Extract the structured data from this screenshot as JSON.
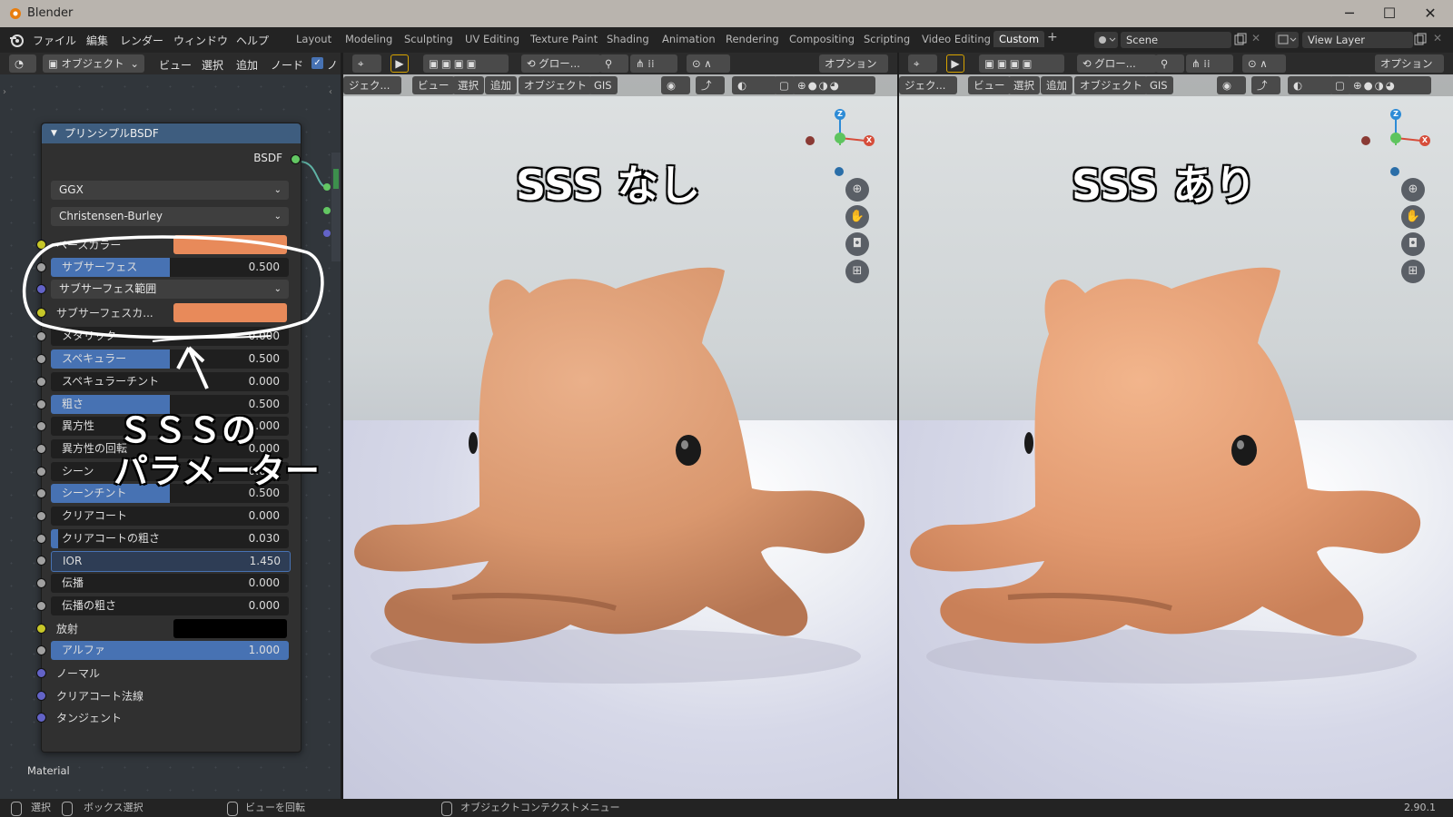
{
  "window": {
    "title": "Blender",
    "minimize": "─",
    "maximize": "☐",
    "close": "✕"
  },
  "menu": {
    "file": "ファイル",
    "edit": "編集",
    "render": "レンダー",
    "window": "ウィンドウ",
    "help": "ヘルプ"
  },
  "workspaces": [
    "Layout",
    "Modeling",
    "Sculpting",
    "UV Editing",
    "Texture Paint",
    "Shading",
    "Animation",
    "Rendering",
    "Compositing",
    "Scripting",
    "Video Editing",
    "Custom"
  ],
  "active_workspace": "Custom",
  "add_workspace": "+",
  "scene": {
    "name": "Scene",
    "view_layer": "View Layer"
  },
  "node_editor": {
    "header": {
      "object": "オブジェクト",
      "view": "ビュー",
      "select": "選択",
      "add": "追加",
      "node": "ノード",
      "extra": "ノ"
    },
    "footer_label": "Material",
    "node": {
      "title": "プリンシプルBSDF",
      "output": "BSDF",
      "distribution": "GGX",
      "subsurface_method": "Christensen-Burley",
      "inputs": [
        {
          "label": "ベースカラー",
          "kind": "color",
          "color": "#e88a5a"
        },
        {
          "label": "サブサーフェス",
          "kind": "slider",
          "value": "0.500",
          "fill": 0.5
        },
        {
          "label": "サブサーフェス範囲",
          "kind": "dropdown"
        },
        {
          "label": "サブサーフェスカ...",
          "kind": "color",
          "color": "#e88a5a"
        },
        {
          "label": "メタリック",
          "kind": "slider",
          "value": "0.000",
          "fill": 0
        },
        {
          "label": "スペキュラー",
          "kind": "slider",
          "value": "0.500",
          "fill": 0.5
        },
        {
          "label": "スペキュラーチント",
          "kind": "slider",
          "value": "0.000",
          "fill": 0
        },
        {
          "label": "粗さ",
          "kind": "slider",
          "value": "0.500",
          "fill": 0.5
        },
        {
          "label": "異方性",
          "kind": "slider",
          "value": "0.000",
          "fill": 0
        },
        {
          "label": "異方性の回転",
          "kind": "slider",
          "value": "0.000",
          "fill": 0
        },
        {
          "label": "シーン",
          "kind": "slider",
          "value": "0.000",
          "fill": 0
        },
        {
          "label": "シーンチント",
          "kind": "slider",
          "value": "0.500",
          "fill": 0.5
        },
        {
          "label": "クリアコート",
          "kind": "slider",
          "value": "0.000",
          "fill": 0
        },
        {
          "label": "クリアコートの粗さ",
          "kind": "slider",
          "value": "0.030",
          "fill": 0.03
        },
        {
          "label": "IOR",
          "kind": "field",
          "value": "1.450"
        },
        {
          "label": "伝播",
          "kind": "slider",
          "value": "0.000",
          "fill": 0
        },
        {
          "label": "伝播の粗さ",
          "kind": "slider",
          "value": "0.000",
          "fill": 0
        },
        {
          "label": "放射",
          "kind": "color",
          "color": "#000000"
        },
        {
          "label": "アルファ",
          "kind": "slider",
          "value": "1.000",
          "fill": 1
        },
        {
          "label": "ノーマル",
          "kind": "plain"
        },
        {
          "label": "クリアコート法線",
          "kind": "plain"
        },
        {
          "label": "タンジェント",
          "kind": "plain"
        }
      ]
    }
  },
  "annotation": {
    "line1": "ＳＳＳの",
    "line2": "パラメーター"
  },
  "viewport_header": {
    "transform": "グロー...",
    "options": "オプション",
    "object_mode": "ジェク...",
    "view": "ビュー",
    "select": "選択",
    "add": "追加",
    "object": "オブジェクト",
    "gis": "GIS"
  },
  "viewports": [
    {
      "label": "SSS なし"
    },
    {
      "label": "SSS あり"
    }
  ],
  "gizmo": {
    "z": "Z",
    "x": "X"
  },
  "statusbar": {
    "select": "選択",
    "box_select": "ボックス選択",
    "rotate_view": "ビューを回転",
    "context_menu": "オブジェクトコンテクストメニュー",
    "version": "2.90.1"
  }
}
